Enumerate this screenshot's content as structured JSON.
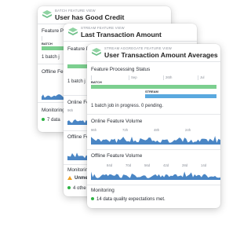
{
  "colors": {
    "batch": "#7ccf8f",
    "stream": "#5aa9df",
    "ok": "#2fb344",
    "warn": "#f0a020",
    "icon": "#6fc08a"
  },
  "cards": [
    {
      "subtitle": "BATCH FEATURE VIEW",
      "title": "User has Good Credit",
      "processing_title": "Feature P",
      "batch_label": "BATCH",
      "status": "1 batch j",
      "offline_title": "Offline Fe",
      "monitoring_title": "Monitoring",
      "monitoring_status": "7 data"
    },
    {
      "subtitle": "STREAM FEATURE VIEW",
      "title": "Last Transaction Amount",
      "processing_title": "Feature P",
      "status": "1 batch j",
      "online_title": "Online Fe",
      "online_tick": "96h",
      "offline_title": "Offline Fe",
      "monitoring_title": "Monitorin",
      "monitoring_warning": "Unme",
      "monitoring_status": "4 othe"
    },
    {
      "subtitle": "STREAM AGGREGATE FEATURE VIEW",
      "title": "User Transaction Amount Averages",
      "processing_title": "Feature Processing Status",
      "processing_ticks": [
        "Sep",
        "26th",
        "Jul"
      ],
      "batch_label": "BATCH",
      "stream_label": "STREAM",
      "status": "1 batch job in progress. 0 pending.",
      "online_title": "Online Feature Volume",
      "online_ticks": [
        "96h",
        "72h",
        "48h",
        "24h"
      ],
      "offline_title": "Offline Feature Volume",
      "offline_ticks": [
        "84d",
        "70d",
        "56d",
        "42d",
        "28d",
        "14d"
      ],
      "monitoring_title": "Monitoring",
      "monitoring_status": "14 data quality expectations met."
    }
  ]
}
